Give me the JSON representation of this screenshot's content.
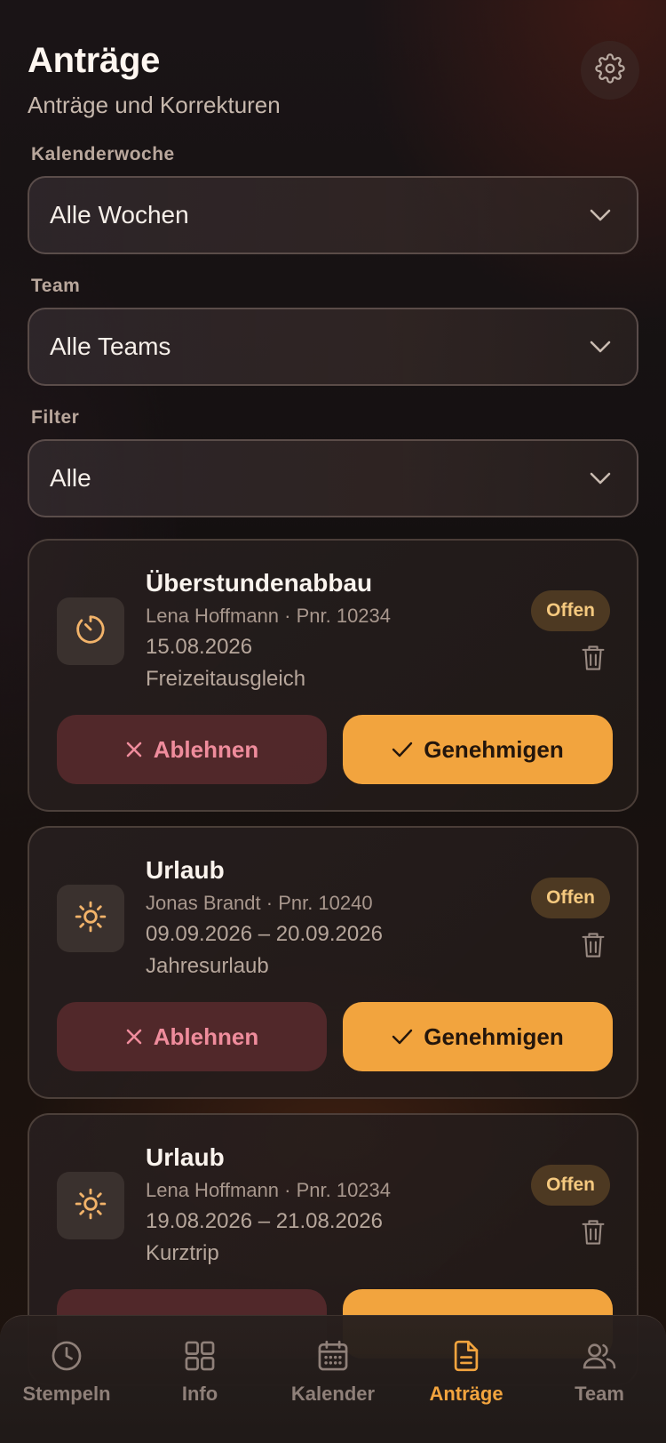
{
  "header": {
    "title": "Anträge",
    "subtitle": "Anträge und Korrekturen",
    "settings_icon": "gear-icon"
  },
  "filters": {
    "week": {
      "label": "Kalenderwoche",
      "value": "Alle Wochen"
    },
    "team": {
      "label": "Team",
      "value": "Alle Teams"
    },
    "filter": {
      "label": "Filter",
      "value": "Alle"
    }
  },
  "requests": [
    {
      "type": "Überstundenabbau",
      "icon": "timer-icon",
      "person": "Lena Hoffmann · Pnr. 10234",
      "date": "15.08.2026",
      "note": "Freizeitausgleich",
      "status": "Offen"
    },
    {
      "type": "Urlaub",
      "icon": "sun-icon",
      "person": "Jonas Brandt · Pnr. 10240",
      "date": "09.09.2026 – 20.09.2026",
      "note": "Jahresurlaub",
      "status": "Offen"
    },
    {
      "type": "Urlaub",
      "icon": "sun-icon",
      "person": "Lena Hoffmann · Pnr. 10234",
      "date": "19.08.2026 – 21.08.2026",
      "note": "Kurztrip",
      "status": "Offen"
    }
  ],
  "actions": {
    "reject_label": "Ablehnen",
    "approve_label": "Genehmigen"
  },
  "nav": {
    "items": [
      {
        "label": "Stempeln",
        "icon": "clock-icon"
      },
      {
        "label": "Info",
        "icon": "grid-icon"
      },
      {
        "label": "Kalender",
        "icon": "calendar-icon"
      },
      {
        "label": "Anträge",
        "icon": "document-icon",
        "active": true
      },
      {
        "label": "Team",
        "icon": "users-icon"
      }
    ]
  },
  "colors": {
    "accent": "#f2a43e",
    "reject_text": "#ef8c9c",
    "badge_text": "#f5c97f"
  }
}
